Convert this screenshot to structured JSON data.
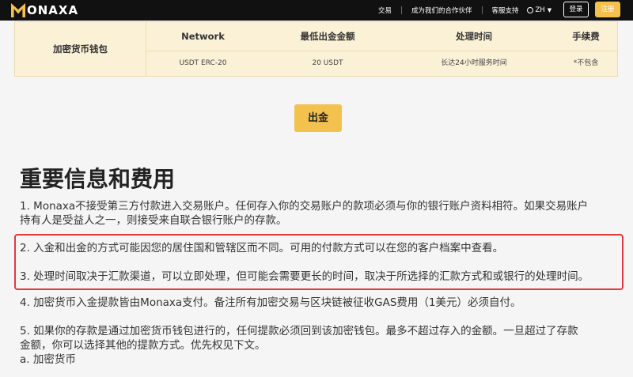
{
  "header": {
    "logo_letter": "M",
    "logo_text": "ONAXA",
    "nav": [
      "交易",
      "成为我们的合作伙伴",
      "客服支持"
    ],
    "lang": "ZH",
    "login": "登录",
    "register": "注册"
  },
  "table": {
    "row_title": "加密货币钱包",
    "headers": [
      "Network",
      "最低出金金额",
      "处理时间",
      "手续费"
    ],
    "cells": [
      "USDT ERC-20",
      "20 USDT",
      "长达24小时服务时间",
      "*不包含"
    ]
  },
  "withdraw_button": "出金",
  "section": {
    "title": "重要信息和费用",
    "p1_line1": "1. Monaxa不接受第三方付款进入交易账户。任何存入你的交易账户的款项必须与你的银行账户资料相符。如果交易账户",
    "p1_line2": "持有人是受益人之一，则接受来自联合银行账户的存款。",
    "p2": "2. 入金和出金的方式可能因您的居住国和管辖区而不同。可用的付款方式可以在您的客户档案中查看。",
    "p3": "3. 处理时间取决于汇款渠道，可以立即处理，但可能会需要更长的时间，取决于所选择的汇款方式和或银行的处理时间。",
    "p4": "4. 加密货币入金提款皆由Monaxa支付。备注所有加密交易与区块链被征收GAS费用（1美元）必须自付。",
    "p5_line1": "5. 如果你的存款是通过加密货币钱包进行的，任何提款必须回到该加密钱包。最多不超过存入的金额。一旦超过了存款",
    "p5_line2": "金额，你可以选择其他的提款方式。优先权见下文。",
    "p5_line3": "a. 加密货币"
  },
  "colors": {
    "accent": "#f2c14e",
    "topbar": "#111111",
    "highlight_border": "#e23b3b",
    "table_bg": "#fbf1d6"
  }
}
